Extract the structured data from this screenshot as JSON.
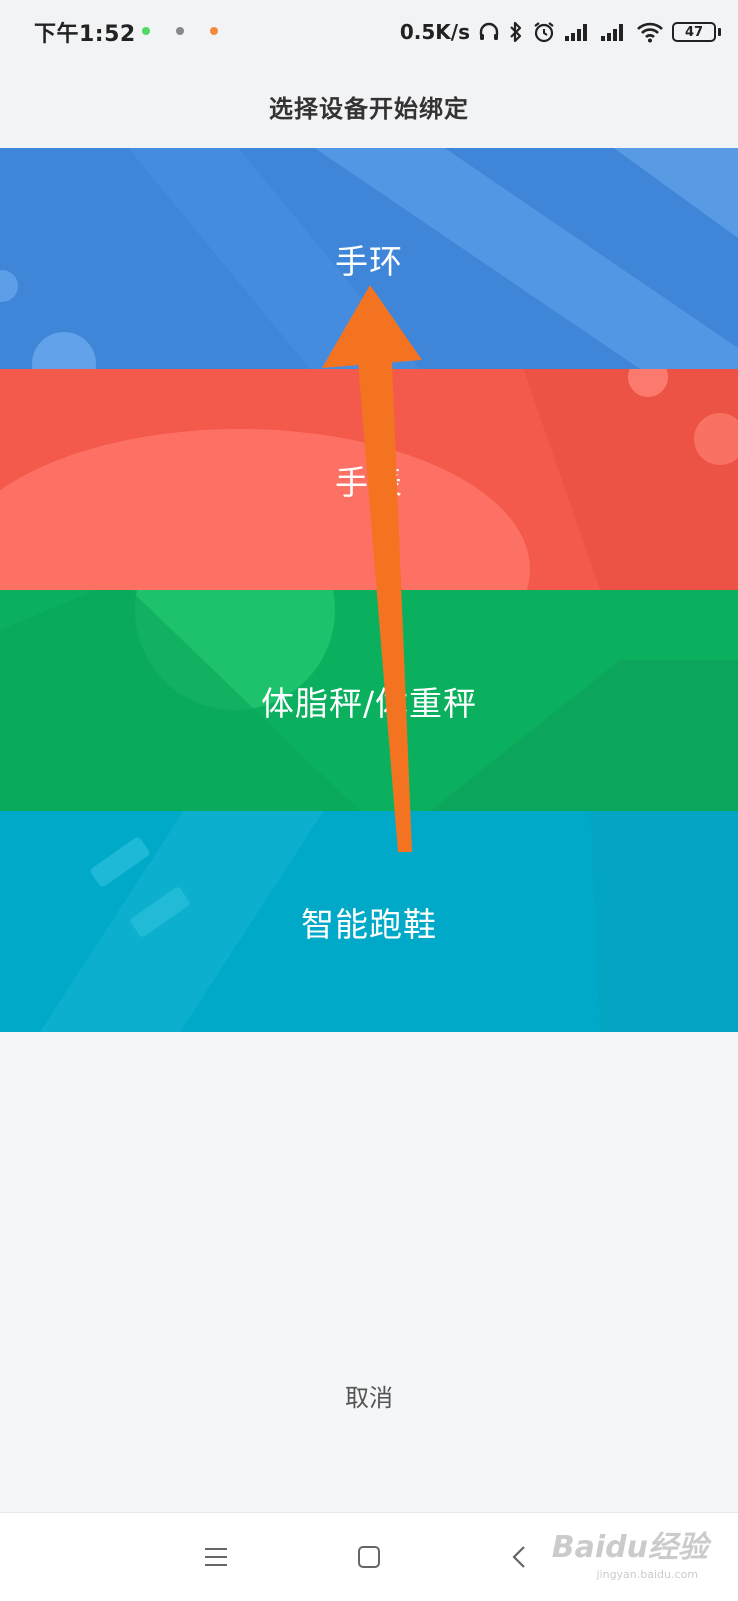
{
  "status_bar": {
    "time": "下午1:52",
    "network_speed": "0.5K/s",
    "battery_level": "47",
    "icons": [
      "headphones-icon",
      "bluetooth-icon",
      "alarm-icon",
      "signal-icon",
      "signal-icon",
      "wifi-icon",
      "battery-icon"
    ]
  },
  "header": {
    "title": "选择设备开始绑定"
  },
  "devices": [
    {
      "label": "手环",
      "color": "#3f86d9"
    },
    {
      "label": "手表",
      "color": "#f35a4b"
    },
    {
      "label": "体脂秤/体重秤",
      "color": "#0bb05f"
    },
    {
      "label": "智能跑鞋",
      "color": "#00a9c8"
    }
  ],
  "cancel_label": "取消",
  "nav_bar": {
    "icons": [
      "menu-icon",
      "home-icon",
      "back-icon"
    ]
  },
  "watermark": {
    "text": "Baidu经验",
    "sub": "jingyan.baidu.com"
  },
  "annotation": {
    "color": "#f47321"
  }
}
